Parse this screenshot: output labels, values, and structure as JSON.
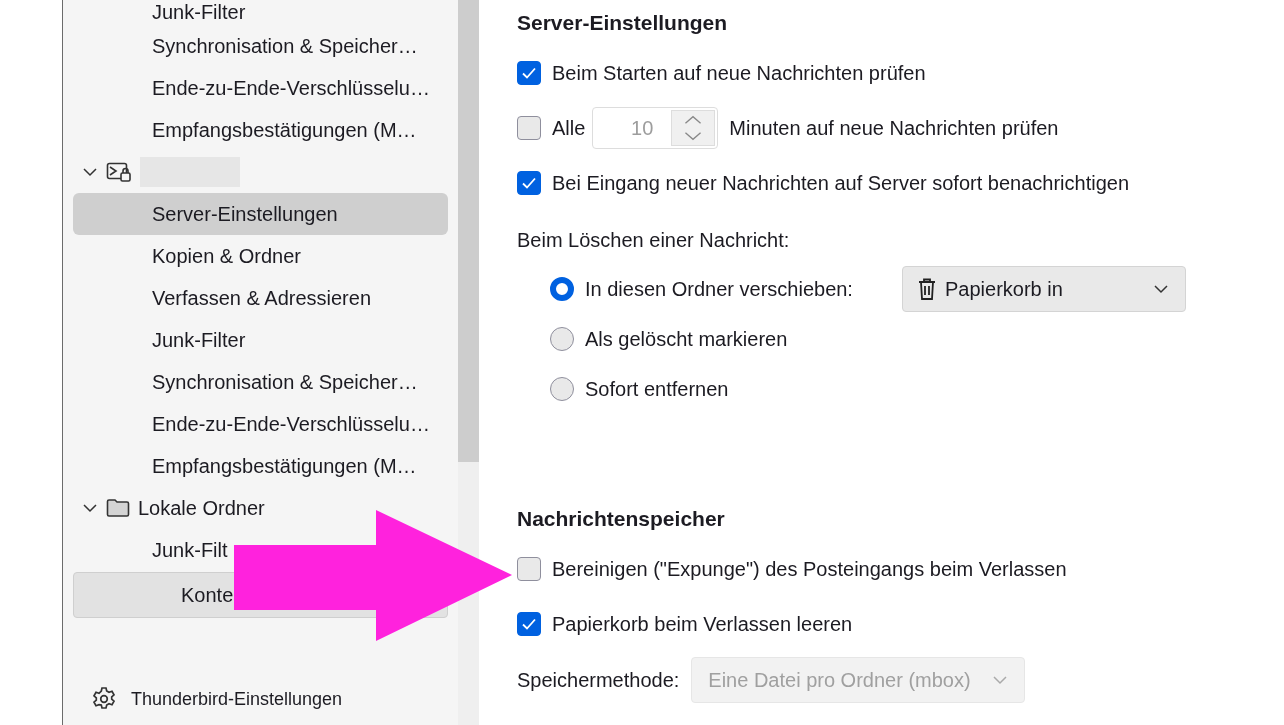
{
  "sidebar": {
    "tree": [
      {
        "kind": "page",
        "label": "Junk-Filter",
        "selected": false
      },
      {
        "kind": "page",
        "label": "Synchronisation & Speicher…",
        "selected": false
      },
      {
        "kind": "page",
        "label": "Ende-zu-Ende-Verschlüsselu…",
        "selected": false
      },
      {
        "kind": "page",
        "label": "Empfangsbestätigungen (M…",
        "selected": false
      },
      {
        "kind": "hidden-account",
        "expanded": true,
        "children": [
          {
            "kind": "page",
            "label": "Server-Einstellungen",
            "selected": true
          },
          {
            "kind": "page",
            "label": "Kopien & Ordner",
            "selected": false
          },
          {
            "kind": "page",
            "label": "Verfassen & Adressieren",
            "selected": false
          },
          {
            "kind": "page",
            "label": "Junk-Filter",
            "selected": false
          },
          {
            "kind": "page",
            "label": "Synchronisation & Speicher…",
            "selected": false
          },
          {
            "kind": "page",
            "label": "Ende-zu-Ende-Verschlüsselu…",
            "selected": false
          },
          {
            "kind": "page",
            "label": "Empfangsbestätigungen (M…",
            "selected": false
          }
        ]
      },
      {
        "kind": "local-folders",
        "label": "Lokale Ordner",
        "expanded": true,
        "children": [
          {
            "kind": "page",
            "label": "Junk-Filt",
            "selected": false
          }
        ]
      }
    ],
    "account_actions_button": "Konte",
    "settings_link": "Thunderbird-Einstellungen"
  },
  "content": {
    "sections": [
      {
        "title": "Server-Einstellungen",
        "rows": [
          {
            "kind": "checkbox",
            "label": "Beim Starten auf neue Nachrichten prüfen",
            "checked": true
          },
          {
            "kind": "checkbox-number",
            "label": "Alle",
            "checked": false,
            "value": "10",
            "disabled": true,
            "suffix": "Minuten auf neue Nachrichten prüfen"
          },
          {
            "kind": "checkbox",
            "label": "Bei Eingang neuer Nachrichten auf Server sofort benachrichtigen",
            "checked": true
          },
          {
            "kind": "label",
            "label": "Beim Löschen einer Nachricht:"
          },
          {
            "kind": "radio",
            "label": "In diesen Ordner verschieben:",
            "selected": true,
            "dropdown": "Papierkorb in"
          },
          {
            "kind": "radio",
            "label": "Als gelöscht markieren",
            "selected": false
          },
          {
            "kind": "radio",
            "label": "Sofort entfernen",
            "selected": false
          }
        ]
      },
      {
        "title": "Nachrichtenspeicher",
        "rows": [
          {
            "kind": "checkbox",
            "label": "Bereinigen (\"Expunge\") des Posteingangs beim Verlassen",
            "checked": false
          },
          {
            "kind": "checkbox",
            "label": "Papierkorb beim Verlassen leeren",
            "checked": true
          },
          {
            "kind": "select",
            "label": "Speichermethode:",
            "value": "Eine Datei pro Ordner (mbox)",
            "disabled": true
          }
        ]
      }
    ]
  }
}
